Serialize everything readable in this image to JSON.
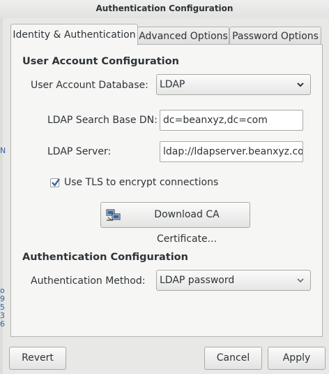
{
  "window": {
    "title": "Authentication Configuration"
  },
  "tabs": [
    {
      "label": "Identity & Authentication",
      "active": true
    },
    {
      "label": "Advanced Options",
      "active": false
    },
    {
      "label": "Password Options",
      "active": false
    }
  ],
  "user_account": {
    "section_title": "User Account Configuration",
    "database_label": "User Account Database:",
    "database_value": "LDAP",
    "search_base_label": "LDAP Search Base DN:",
    "search_base_value": "dc=beanxyz,dc=com",
    "server_label": "LDAP Server:",
    "server_value": "ldap://ldapserver.beanxyz.com",
    "tls_label": "Use TLS to encrypt connections",
    "tls_checked": true,
    "download_label": "Download CA Certificate..."
  },
  "auth": {
    "section_title": "Authentication Configuration",
    "method_label": "Authentication Method:",
    "method_value": "LDAP password"
  },
  "footer": {
    "revert_label": "Revert",
    "cancel_label": "Cancel",
    "apply_label": "Apply"
  },
  "colors": {
    "accent": "#3465a4",
    "window_bg": "#e8e8e7",
    "panel_bg": "#f6f6f5"
  }
}
